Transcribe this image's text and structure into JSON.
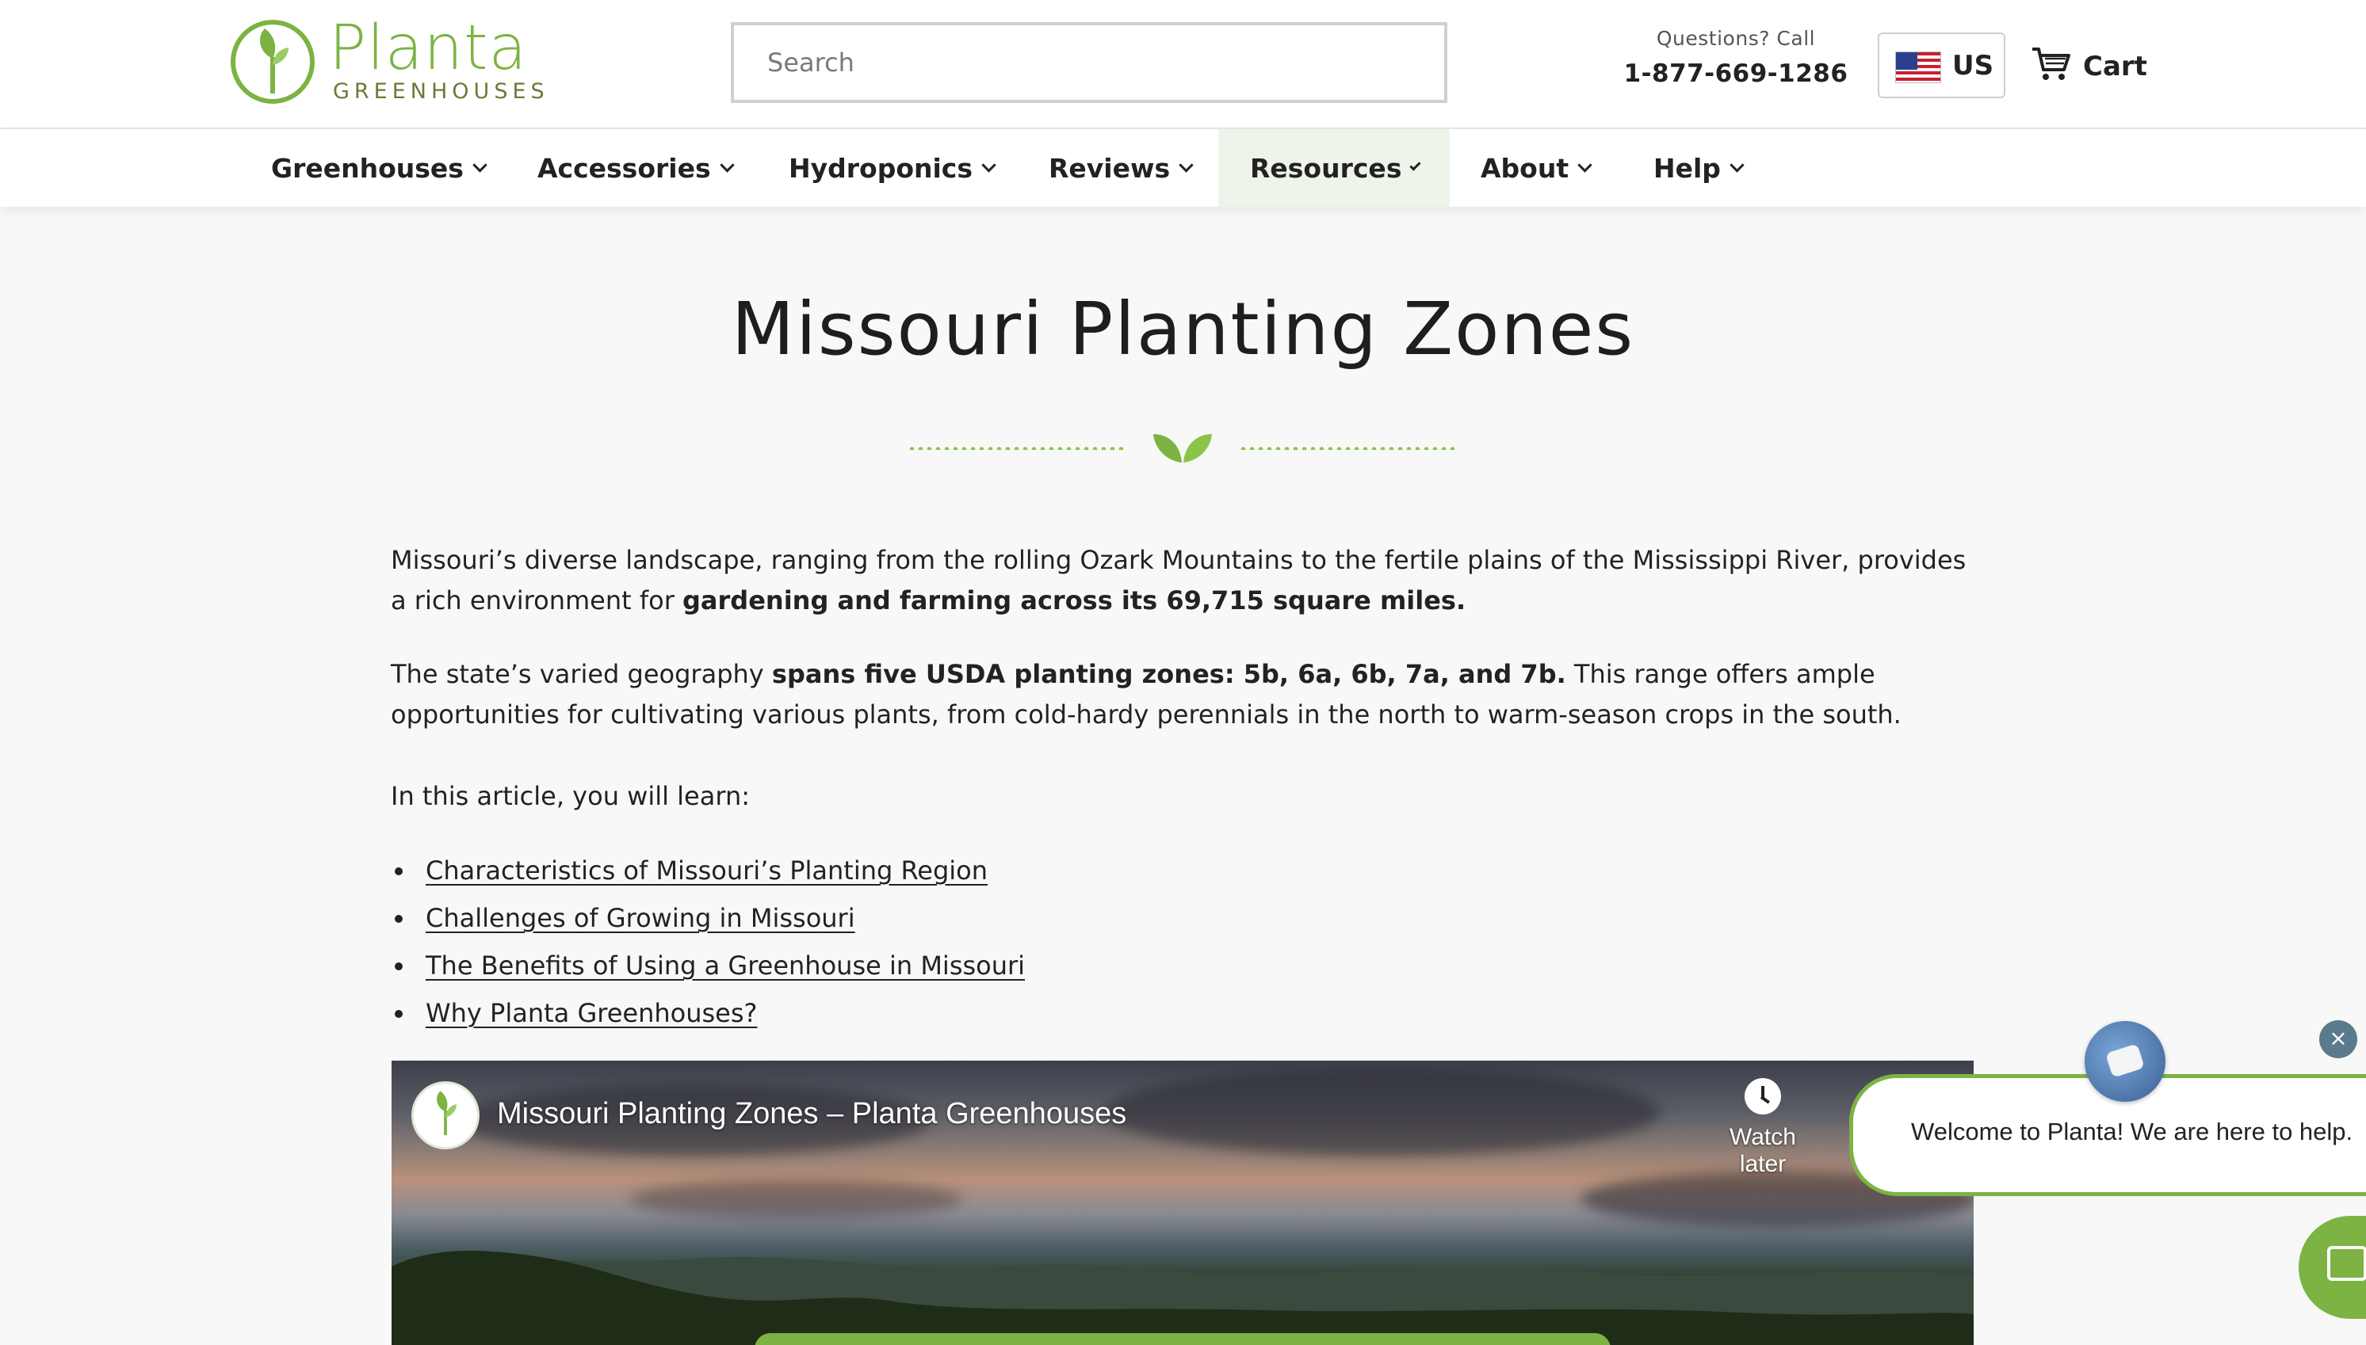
{
  "header": {
    "logo": {
      "name": "Planta",
      "subtitle": "GREENHOUSES"
    },
    "search": {
      "placeholder": "Search",
      "value": ""
    },
    "contact": {
      "label": "Questions? Call",
      "phone": "1-877-669-1286"
    },
    "region": {
      "label": "US",
      "flag_icon": "us-flag-icon"
    },
    "cart": {
      "label": "Cart",
      "icon": "cart-icon"
    }
  },
  "nav": {
    "items": [
      {
        "label": "Greenhouses"
      },
      {
        "label": "Accessories"
      },
      {
        "label": "Hydroponics"
      },
      {
        "label": "Reviews"
      },
      {
        "label": "Resources",
        "active": true
      },
      {
        "label": "About"
      },
      {
        "label": "Help"
      }
    ]
  },
  "main": {
    "title": "Missouri Planting Zones",
    "p1": {
      "a": "Missouri’s diverse landscape, ranging from the rolling Ozark Mountains to the fertile plains of the Mississippi River, provides a rich environment for ",
      "b": "gardening and farming across its 69,715 square miles."
    },
    "p2": {
      "a": "The state’s varied geography ",
      "b": "spans five USDA planting zones: 5b, 6a, 6b, 7a, and 7b.",
      "c": " This range offers ample opportunities for cultivating various plants, from cold-hardy perennials in the north to warm-season crops in the south."
    },
    "p3": "In this article, you will learn:",
    "toc": [
      "Characteristics of Missouri’s Planting Region ",
      "Challenges of Growing in Missouri",
      "The Benefits of Using a Greenhouse in Missouri",
      "Why Planta Greenhouses? "
    ]
  },
  "video": {
    "title": "Missouri Planting Zones – Planta Greenhouses",
    "watch_later": "Watch later"
  },
  "chat": {
    "message": "Welcome to Planta! We are here to help.",
    "close_label": "×"
  },
  "colors": {
    "brand_green": "#7cb342",
    "nav_active_bg": "#eef4ea",
    "page_bg": "#f7f8f7"
  }
}
